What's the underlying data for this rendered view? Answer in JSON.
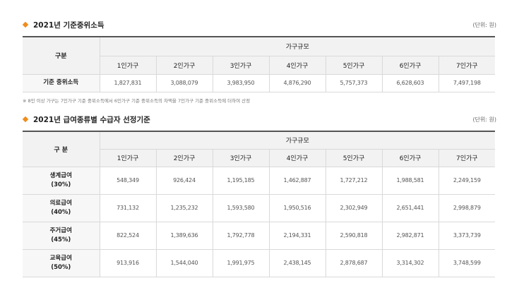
{
  "section1": {
    "title": "2021년 기준중위소득",
    "unit": "(단위: 원)",
    "row_header": "구분",
    "group_header": "가구규모",
    "columns": [
      "1인가구",
      "2인가구",
      "3인가구",
      "4인가구",
      "5인가구",
      "6인가구",
      "7인가구"
    ],
    "row": {
      "label": "기준 중위소득",
      "values": [
        "1,827,831",
        "3,088,079",
        "3,983,950",
        "4,876,290",
        "5,757,373",
        "6,628,603",
        "7,497,198"
      ]
    }
  },
  "note": "※ 8인 이상 가구는 7인가구 기준 중위소득에서 6인가구 기준 중위소득의 차액을 7인가구 기준 중위소득에 더하여 산정",
  "section2": {
    "title": "2021년 급여종류별 수급자 선정기준",
    "unit": "(단위: 원)",
    "row_header": "구 분",
    "group_header": "가구규모",
    "columns": [
      "1인가구",
      "2인가구",
      "3인가구",
      "4인가구",
      "5인가구",
      "6인가구",
      "7인가구"
    ],
    "rows": [
      {
        "label": "생계급여",
        "sub": "(30%)",
        "values": [
          "548,349",
          "926,424",
          "1,195,185",
          "1,462,887",
          "1,727,212",
          "1,988,581",
          "2,249,159"
        ]
      },
      {
        "label": "의료급여",
        "sub": "(40%)",
        "values": [
          "731,132",
          "1,235,232",
          "1,593,580",
          "1,950,516",
          "2,302,949",
          "2,651,441",
          "2,998,879"
        ]
      },
      {
        "label": "주거급여",
        "sub": "(45%)",
        "values": [
          "822,524",
          "1,389,636",
          "1,792,778",
          "2,194,331",
          "2,590,818",
          "2,982,871",
          "3,373,739"
        ]
      },
      {
        "label": "교육급여",
        "sub": "(50%)",
        "values": [
          "913,916",
          "1,544,040",
          "1,991,975",
          "2,438,145",
          "2,878,687",
          "3,314,302",
          "3,748,599"
        ]
      }
    ]
  },
  "colors": {
    "accent": "#f08c1c",
    "header_bg": "#f2f2f2",
    "border": "#d9d9d9"
  }
}
